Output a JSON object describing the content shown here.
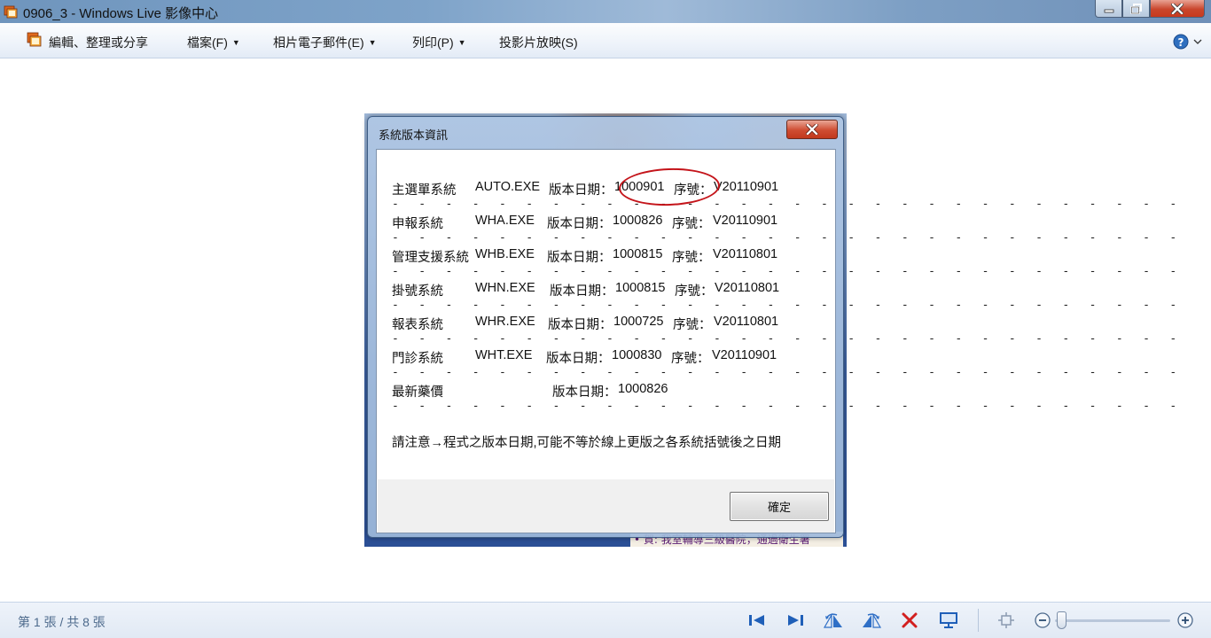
{
  "window": {
    "title": "0906_3 - Windows Live 影像中心",
    "app_icon": "photo-gallery-icon"
  },
  "menu": {
    "items": [
      {
        "label": "編輯、整理或分享",
        "has_dropdown": false,
        "icon": "organize-icon"
      },
      {
        "label": "檔案(F)",
        "has_dropdown": true
      },
      {
        "label": "相片電子郵件(E)",
        "has_dropdown": true
      },
      {
        "label": "列印(P)",
        "has_dropdown": true
      },
      {
        "label": "投影片放映(S)",
        "has_dropdown": false
      }
    ],
    "help_icon": "help-icon"
  },
  "photo": {
    "caption": "• 賀: 我室輔導三級醫院，通過衛生署"
  },
  "dialog": {
    "title": "系統版本資訊",
    "rows": [
      {
        "name": "主選單系統",
        "exe": "AUTO.EXE",
        "date_label": "版本日期：",
        "date": "1000901",
        "serial_label": "序號：",
        "serial": "V20110901"
      },
      {
        "name": "申報系統",
        "exe": "WHA.EXE",
        "date_label": "版本日期：",
        "date": "1000826",
        "serial_label": "序號：",
        "serial": "V20110901"
      },
      {
        "name": "管理支援系統",
        "exe": "WHB.EXE",
        "date_label": "版本日期：",
        "date": "1000815",
        "serial_label": "序號：",
        "serial": "V20110801"
      },
      {
        "name": "掛號系統",
        "exe": "WHN.EXE",
        "date_label": "版本日期：",
        "date": "1000815",
        "serial_label": "序號：",
        "serial": "V20110801"
      },
      {
        "name": "報表系統",
        "exe": "WHR.EXE",
        "date_label": "版本日期：",
        "date": "1000725",
        "serial_label": "序號：",
        "serial": "V20110801"
      },
      {
        "name": "門診系統",
        "exe": "WHT.EXE",
        "date_label": "版本日期：",
        "date": "1000830",
        "serial_label": "序號：",
        "serial": "V20110901"
      },
      {
        "name": "最新藥價",
        "exe": "",
        "date_label": "版本日期：",
        "date": "1000826",
        "serial_label": "",
        "serial": ""
      }
    ],
    "separator": "- - - - - - - - - - - - - - - - - - - - - - - - - - - - - -",
    "note": "請注意→程式之版本日期,可能不等於線上更版之各系統括號後之日期",
    "ok_label": "確定",
    "highlight_color": "#c4141a"
  },
  "status": {
    "counter": "第 1 張 / 共 8 張",
    "controls": [
      "previous-icon",
      "next-icon",
      "rotate-left-icon",
      "rotate-right-icon",
      "delete-icon",
      "slideshow-icon",
      "fit-window-icon",
      "zoom-out-icon",
      "zoom-in-icon"
    ],
    "zoom_level": 0.05
  }
}
